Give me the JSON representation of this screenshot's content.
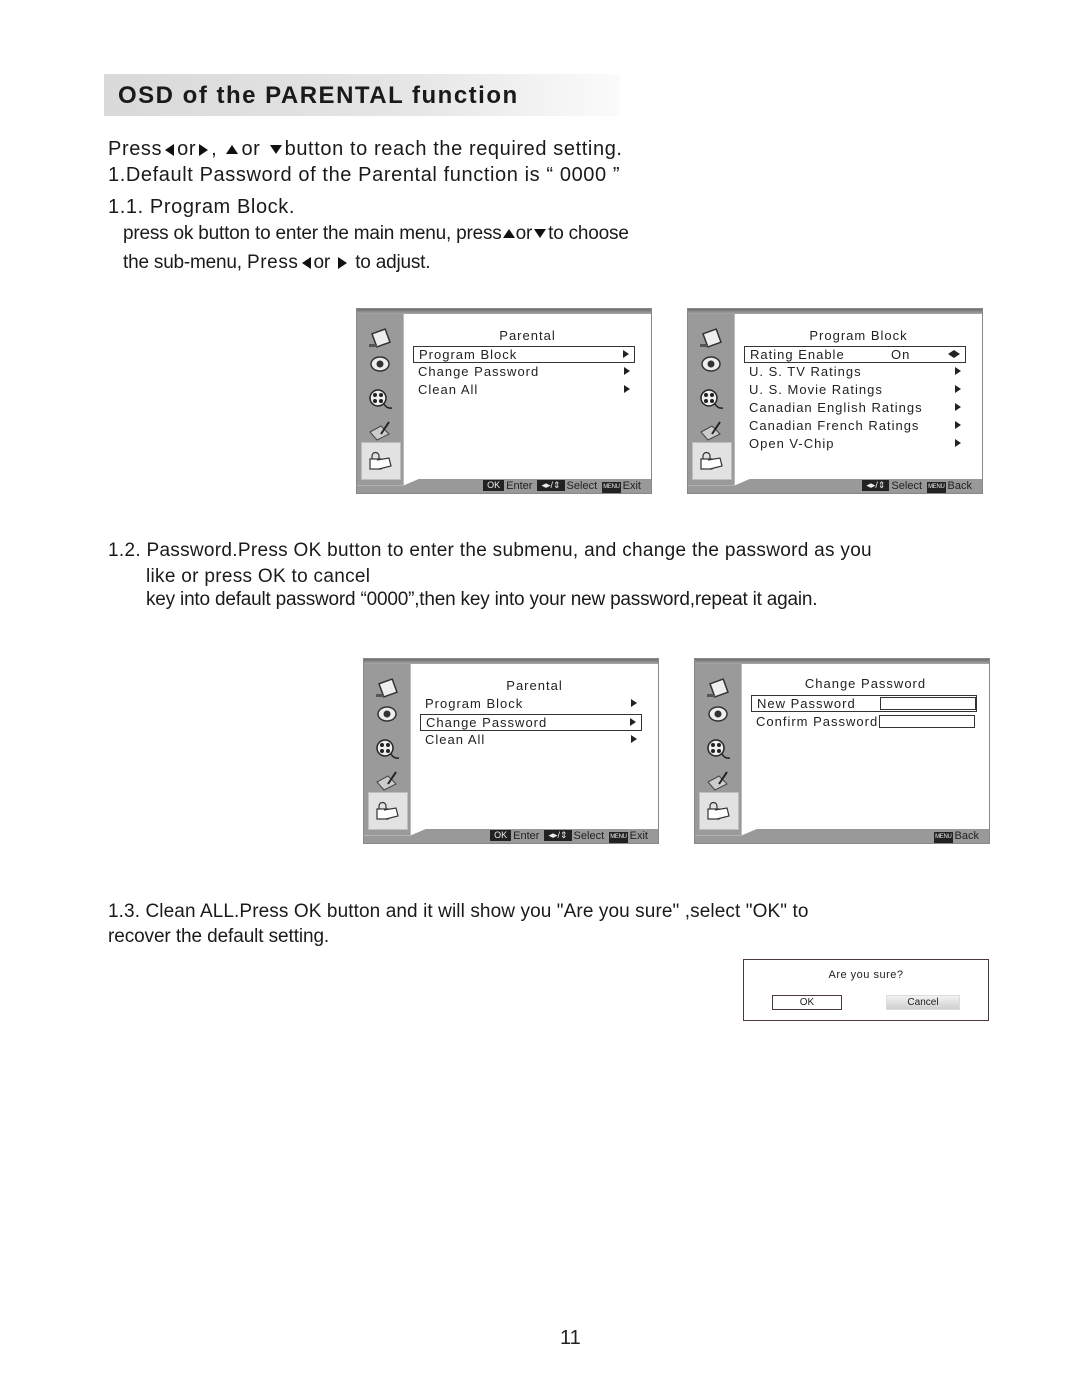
{
  "heading": "OSD of the PARENTAL function",
  "intro": {
    "nav_line": {
      "press": "Press",
      "or1": "or",
      "comma": ",",
      "or2": "or",
      "rest": "button to reach the required setting."
    },
    "default_pw": "1.Default Password of the Parental function is “ 0000 ”"
  },
  "section_1_1": {
    "title": "1.1. Program Block.",
    "line1_a": "press ok button to enter the main menu, press",
    "line1_or": "or",
    "line1_b": "to choose",
    "line2_a": "the sub-menu,",
    "line2_press": "Press",
    "line2_or": "or",
    "line2_b": "to adjust."
  },
  "section_1_2": {
    "line1": "1.2. Password.Press OK button to enter the submenu, and change the password as you",
    "line2": "like or press OK to cancel",
    "line3": "key into default password “0000”,then key into your new password,repeat it again."
  },
  "section_1_3": {
    "line1": "1.3. Clean ALL.Press OK button and it will show you  \"Are you sure\" ,select \"OK\" to",
    "line2": "recover the default setting."
  },
  "sidebar_icons": [
    "picture-icon",
    "sound-icon",
    "channel-icon",
    "setup-icon",
    "parental-lock-icon"
  ],
  "osd_parental_1": {
    "title": "Parental",
    "items": [
      {
        "label": "Program  Block",
        "selected": true
      },
      {
        "label": "Change  Password",
        "selected": false
      },
      {
        "label": "Clean  All",
        "selected": false
      }
    ],
    "hint": {
      "ok": "OK",
      "enter": "Enter",
      "nav": "◆/♦",
      "select": "Select",
      "menu": "MENU",
      "exit": "Exit"
    }
  },
  "osd_program_block": {
    "title": "Program  Block",
    "items": [
      {
        "label": "Rating  Enable",
        "value": "On",
        "selected": true
      },
      {
        "label": "U. S.  TV  Ratings"
      },
      {
        "label": "U. S.  Movie  Ratings"
      },
      {
        "label": "Canadian  English  Ratings"
      },
      {
        "label": "Canadian  French  Ratings"
      },
      {
        "label": "Open  V-Chip"
      }
    ],
    "hint": {
      "select": "Select",
      "menu": "MENU",
      "back": "Back"
    }
  },
  "osd_parental_2": {
    "title": "Parental",
    "items": [
      {
        "label": "Program  Block",
        "selected": false
      },
      {
        "label": "Change  Password",
        "selected": true
      },
      {
        "label": "Clean  All",
        "selected": false
      }
    ],
    "hint": {
      "ok": "OK",
      "enter": "Enter",
      "select": "Select",
      "menu": "MENU",
      "exit": "Exit"
    }
  },
  "osd_change_password": {
    "title": "Change  Password",
    "items": [
      {
        "label": "New  Password",
        "value": "",
        "selected": true
      },
      {
        "label": "Confirm  Password",
        "value": "",
        "selected": false
      }
    ],
    "hint": {
      "menu": "MENU",
      "back": "Back"
    }
  },
  "confirm_dialog": {
    "question": "Are you sure?",
    "ok": "OK",
    "cancel": "Cancel"
  },
  "page_number": "11"
}
